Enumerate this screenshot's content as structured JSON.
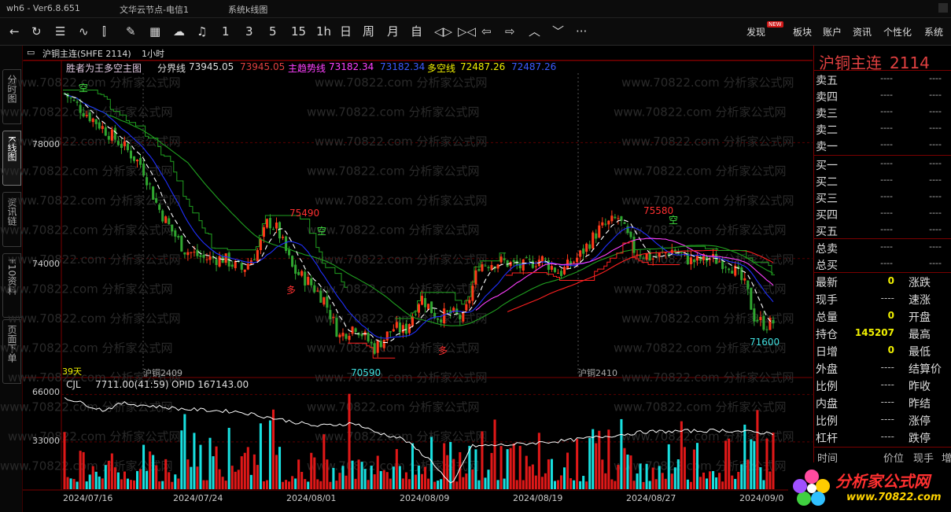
{
  "window": {
    "title_left": "wh6 - Ver6.8.651",
    "title_mid": "文华云节点-电信1",
    "title_right": "系统k线图"
  },
  "toolbar": {
    "periods": [
      "1",
      "3",
      "5",
      "15",
      "1h",
      "日",
      "周",
      "月",
      "自"
    ],
    "right_items": [
      "发现",
      "板块",
      "账户",
      "资讯",
      "个性化",
      "系统"
    ],
    "new_badge": "NEW",
    "more": "···"
  },
  "left_tabs": [
    "分时图",
    "K线图",
    "资讯链",
    "F10资料",
    "页面下单"
  ],
  "chart_header": {
    "contract": "沪铜主连(SHFE 2114)",
    "period": "1小时"
  },
  "indicator": {
    "name": "胜者为王多空主图",
    "items": [
      {
        "label": "分界线",
        "value": "73945.05",
        "value2": "73945.05"
      },
      {
        "label": "主趋势线",
        "value": "73182.34",
        "value2": "73182.34"
      },
      {
        "label": "多空线",
        "value": "72487.26",
        "value2": "72487.26"
      }
    ]
  },
  "price_axis": [
    "78000",
    "74000"
  ],
  "annotations": {
    "high1": "75490",
    "high2": "75580",
    "low1": "70590",
    "low2": "71600",
    "kong": "空",
    "duo": "多",
    "days": "39天",
    "contract1": "沪铜2409",
    "contract2": "沪铜2410"
  },
  "volume": {
    "name": "CJL",
    "value": "7711.00(41:59)",
    "opid": "OPID 167143.00",
    "axis": [
      "66000",
      "33000"
    ]
  },
  "dates": [
    "2024/07/16",
    "2024/07/24",
    "2024/08/01",
    "2024/08/09",
    "2024/08/19",
    "2024/08/27",
    "2024/09/0"
  ],
  "quote": {
    "name": "沪铜主连",
    "code": "2114",
    "asks": [
      "卖五",
      "卖四",
      "卖三",
      "卖二",
      "卖一"
    ],
    "bids": [
      "买一",
      "买二",
      "买三",
      "买四",
      "买五"
    ],
    "placeholder": "----",
    "totals": [
      "总卖",
      "总买"
    ],
    "stats": [
      {
        "l1": "最新",
        "v": "0",
        "l2": "涨跌"
      },
      {
        "l1": "现手",
        "v": "----",
        "l2": "速涨"
      },
      {
        "l1": "总量",
        "v": "0",
        "l2": "开盘"
      },
      {
        "l1": "持仓",
        "v": "145207",
        "l2": "最高"
      },
      {
        "l1": "日增",
        "v": "0",
        "l2": "最低"
      },
      {
        "l1": "外盘",
        "v": "----",
        "l2": "结算价"
      },
      {
        "l1": "比例",
        "v": "----",
        "l2": "昨收"
      },
      {
        "l1": "内盘",
        "v": "----",
        "l2": "昨结"
      },
      {
        "l1": "比例",
        "v": "----",
        "l2": "涨停"
      },
      {
        "l1": "杠杆",
        "v": "----",
        "l2": "跌停"
      }
    ],
    "footer": [
      "时间",
      "价位",
      "现手",
      "增"
    ]
  },
  "logo": {
    "t1": "分析家公式网",
    "t2": "www.70822.com"
  },
  "watermark": "www.70822.com 分析家公式网",
  "colors": {
    "up": "#ff3a1a",
    "down": "#2fa52f",
    "volup": "#e01818",
    "voldown": "#18e0e0",
    "grid": "#5a0000"
  }
}
